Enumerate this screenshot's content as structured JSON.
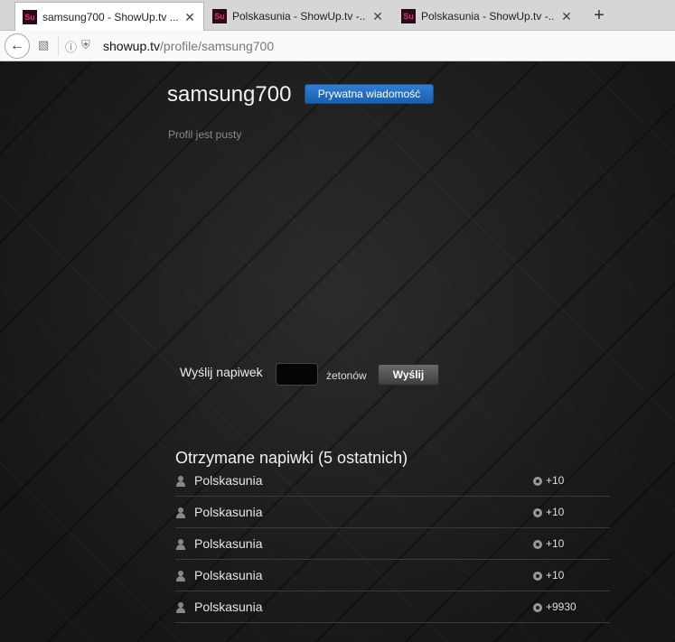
{
  "browser": {
    "tabs": [
      {
        "label": "samsung700 - ShowUp.tv ...",
        "favicon": "Su"
      },
      {
        "label": "Polskasunia - ShowUp.tv -...",
        "favicon": "Su"
      },
      {
        "label": "Polskasunia - ShowUp.tv -...",
        "favicon": "Su"
      }
    ],
    "close_glyph": "✕",
    "new_tab_glyph": "+",
    "url_host": "showup.tv",
    "url_path": "/profile/samsung700"
  },
  "profile": {
    "username": "samsung700",
    "pm_button": "Prywatna wiadomość",
    "empty_text": "Profil jest pusty"
  },
  "tip_form": {
    "label": "Wyślij napiwek",
    "input_value": "",
    "unit": "żetonów",
    "send_label": "Wyślij"
  },
  "tips": {
    "title": "Otrzymane napiwki (5 ostatnich)",
    "rows": [
      {
        "name": "Polskasunia",
        "amount": "+10"
      },
      {
        "name": "Polskasunia",
        "amount": "+10"
      },
      {
        "name": "Polskasunia",
        "amount": "+10"
      },
      {
        "name": "Polskasunia",
        "amount": "+10"
      },
      {
        "name": "Polskasunia",
        "amount": "+9930"
      }
    ]
  }
}
